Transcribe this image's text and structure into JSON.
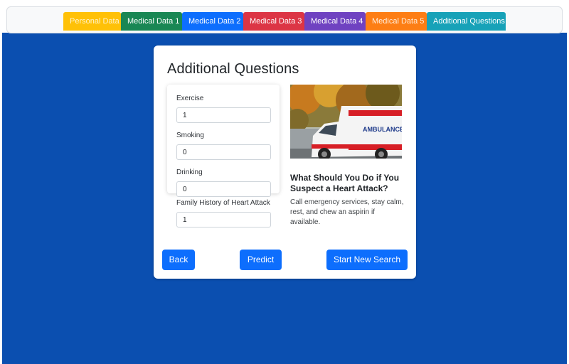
{
  "tabs": [
    {
      "label": "Personal Data",
      "color": "#ffc107",
      "text_color": "#fff3cd"
    },
    {
      "label": "Medical Data 1",
      "color": "#198754",
      "text_color": "#ffffff"
    },
    {
      "label": "Medical Data 2",
      "color": "#0d6efd",
      "text_color": "#ffffff"
    },
    {
      "label": "Medical Data 3",
      "color": "#dc3545",
      "text_color": "#ffffff"
    },
    {
      "label": "Medical Data 4",
      "color": "#6f42c1",
      "text_color": "#ffffff"
    },
    {
      "label": "Medical Data 5",
      "color": "#fd7e14",
      "text_color": "#ffeede"
    },
    {
      "label": "Additional Questions",
      "color": "#17a2b8",
      "text_color": "#ffffff"
    }
  ],
  "form": {
    "title": "Additional Questions",
    "fields": [
      {
        "label": "Exercise",
        "value": "1"
      },
      {
        "label": "Smoking",
        "value": "0"
      },
      {
        "label": "Drinking",
        "value": "0"
      },
      {
        "label": "Family History of Heart Attack",
        "value": "1"
      }
    ]
  },
  "info": {
    "image_text": "AMBULANCE",
    "title": "What Should You Do if You Suspect a Heart Attack?",
    "text": "Call emergency services, stay calm, rest, and chew an aspirin if available."
  },
  "buttons": {
    "back": "Back",
    "predict": "Predict",
    "start_new": "Start New Search"
  },
  "colors": {
    "background": "#0b4fb0",
    "primary_button": "#0d6efd"
  }
}
